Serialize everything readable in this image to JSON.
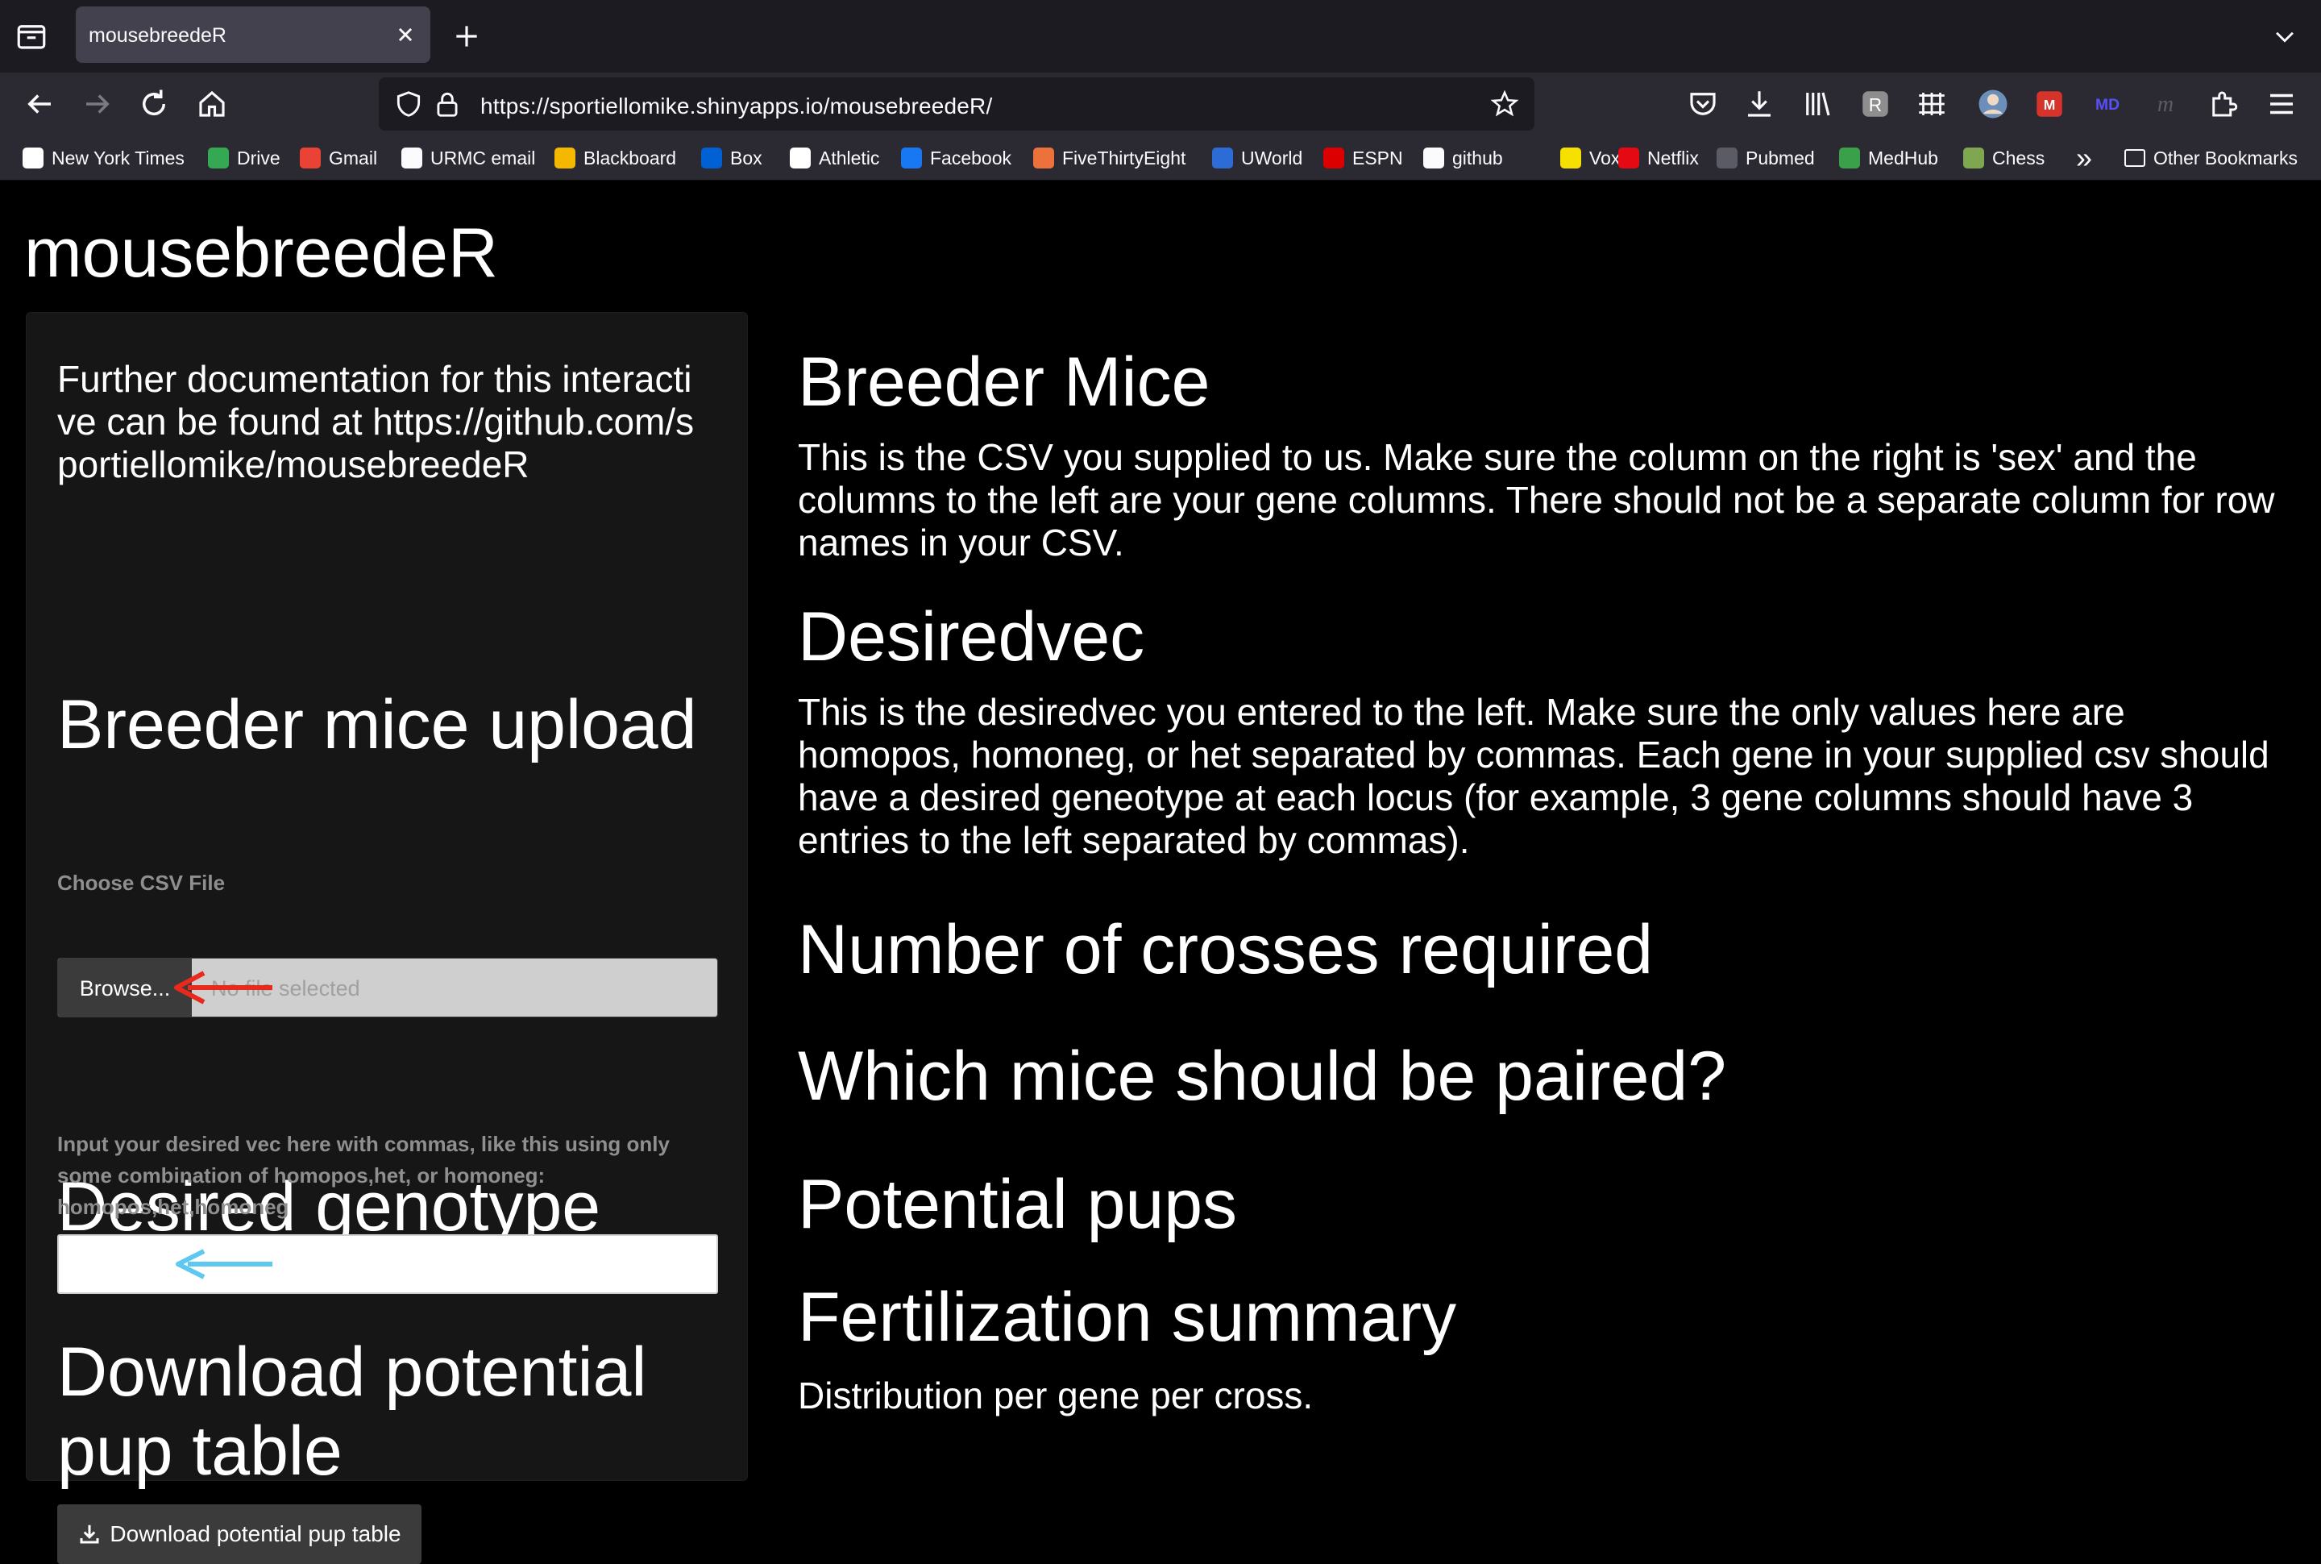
{
  "browser": {
    "tab_title": "mousebreedeR",
    "url": "https://sportiellomike.shinyapps.io/mousebreedeR/",
    "bookmarks": [
      {
        "label": "New York Times",
        "icon": "nyt-icon",
        "color": "#ffffff"
      },
      {
        "label": "Drive",
        "icon": "drive-icon",
        "color": "#34a853"
      },
      {
        "label": "Gmail",
        "icon": "gmail-icon",
        "color": "#ea4335"
      },
      {
        "label": "URMC email",
        "icon": "globe-icon",
        "color": "#fbfbfe"
      },
      {
        "label": "Blackboard",
        "icon": "blackboard-icon",
        "color": "#f5b800"
      },
      {
        "label": "Box",
        "icon": "box-icon",
        "color": "#0061d5"
      },
      {
        "label": "Athletic",
        "icon": "athletic-icon",
        "color": "#ffffff"
      },
      {
        "label": "Facebook",
        "icon": "facebook-icon",
        "color": "#1877f2"
      },
      {
        "label": "FiveThirtyEight",
        "icon": "fivethirtyeight-icon",
        "color": "#ed713a"
      },
      {
        "label": "UWorld",
        "icon": "uworld-icon",
        "color": "#2d6bd6"
      },
      {
        "label": "ESPN",
        "icon": "espn-icon",
        "color": "#d00"
      },
      {
        "label": "github",
        "icon": "github-icon",
        "color": "#fbfbfe"
      },
      {
        "label": "Vox",
        "icon": "vox-icon",
        "color": "#f6e000"
      },
      {
        "label": "Netflix",
        "icon": "netflix-icon",
        "color": "#e50914"
      },
      {
        "label": "Pubmed",
        "icon": "pubmed-icon",
        "color": "#5b5b66"
      },
      {
        "label": "MedHub",
        "icon": "medhub-icon",
        "color": "#3aa04a"
      },
      {
        "label": "Chess",
        "icon": "chess-icon",
        "color": "#7fa650"
      }
    ],
    "other_bookmarks": "Other Bookmarks"
  },
  "app": {
    "title": "mousebreedeR"
  },
  "sidebar": {
    "doc_text": "Further documentation for this interactive can be found at https://github.com/sportiellomike/mousebreedeR",
    "upload_heading": "Breeder mice upload",
    "file_label": "Choose CSV File",
    "browse_label": "Browse...",
    "file_placeholder": "No file selected",
    "genotype_heading": "Desired genotype",
    "genotype_help": "Input your desired vec here with commas, like this using only some combination of homopos,het, or homoneg: homopos,het,homoneg",
    "genotype_value": "",
    "download_heading": "Download potential pup table",
    "download_button": "Download potential pup table"
  },
  "main": {
    "breeder_heading": "Breeder Mice",
    "breeder_text": "This is the CSV you supplied to us. Make sure the column on the right is 'sex' and the columns to the left are your gene columns. There should not be a separate column for row names in your CSV.",
    "desiredvec_heading": "Desiredvec",
    "desiredvec_text": "This is the desiredvec you entered to the left. Make sure the only values here are homopos, homoneg, or het separated by commas. Each gene in your supplied csv should have a desired geneotype at each locus (for example, 3 gene columns should have 3 entries to the left separated by commas).",
    "crosses_heading": "Number of crosses required",
    "paired_heading": "Which mice should be paired?",
    "pups_heading": "Potential pups",
    "fert_heading": "Fertilization summary",
    "fert_text": "Distribution per gene per cross."
  },
  "annotations": {
    "red_arrow_color": "#e8291c",
    "blue_arrow_color": "#5ec8f0"
  }
}
